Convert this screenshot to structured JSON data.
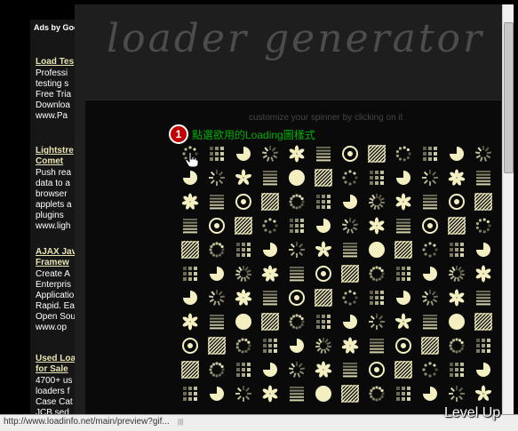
{
  "left_ads": {
    "header": "Ads by Goo",
    "ads": [
      {
        "title": "Load Tes",
        "body": "Professi\ntesting s\nFree Tria\nDownloa\nwww.Pa"
      },
      {
        "title": "Lightstre\nComet",
        "body": "Push rea\ndata to a\nbrowser\napplets a\nplugins\nwww.ligh"
      },
      {
        "title": "AJAX Jav\nFramew",
        "body": "Create A\nEnterpris\nApplicatio\nRapid. Ea\nOpen Sou\nwww.op"
      },
      {
        "title": "Used Loa\nfor Sale",
        "body": "4700+ us\nloaders f\nCase Cat\nJCB sed"
      }
    ]
  },
  "app": {
    "logo": "loader  generator",
    "subtitle": "customize your spinner by clicking on it"
  },
  "annotation": {
    "number": "1",
    "text": "點選欲用的Loading圖樣式"
  },
  "spinner_grid": {
    "rows": 11,
    "cols": 12,
    "color": "#f3efc0"
  },
  "status": {
    "url": "http://www.loadinfo.net/main/preview?gif..."
  },
  "watermark": "Level Up"
}
